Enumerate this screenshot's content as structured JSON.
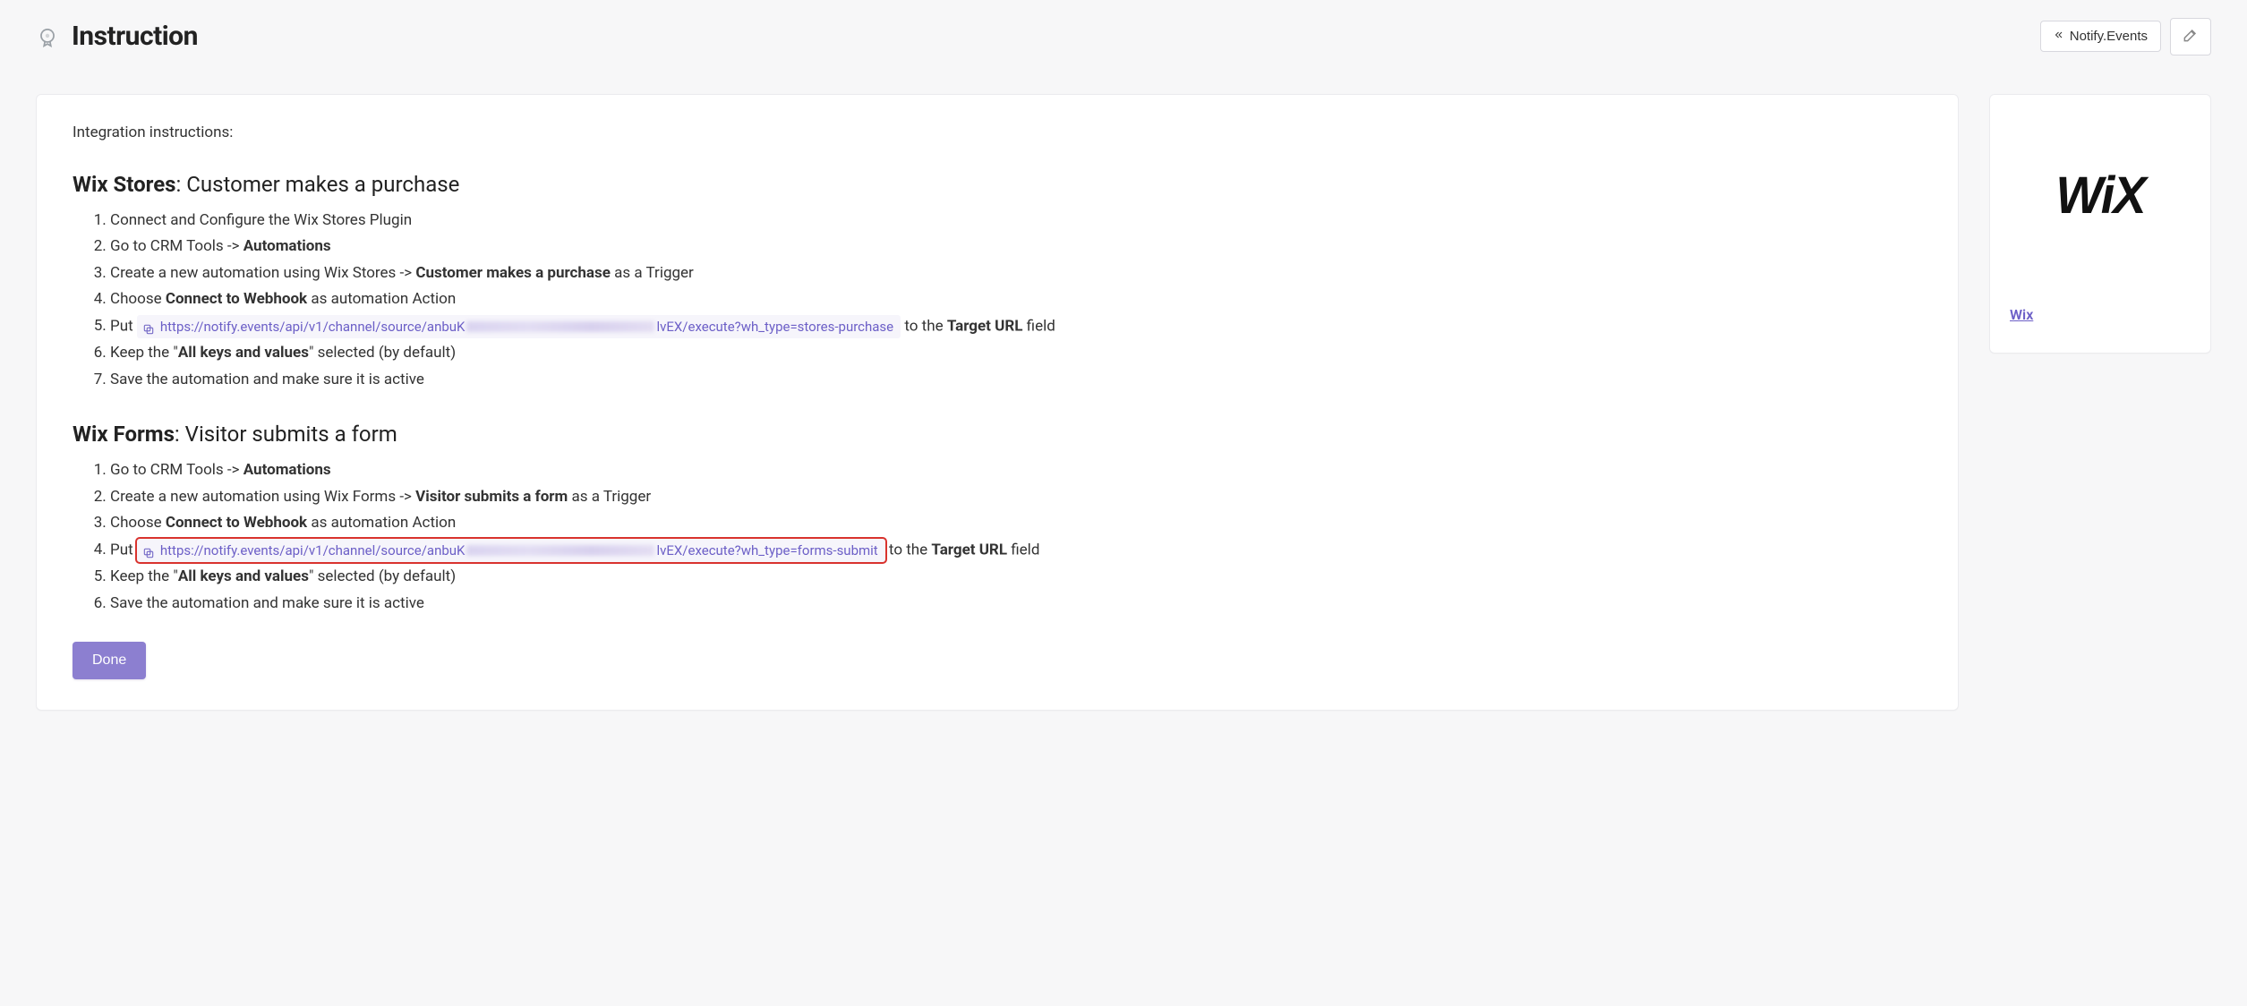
{
  "page": {
    "title": "Instruction",
    "back_button": "Notify.Events"
  },
  "intro": "Integration instructions:",
  "sections": [
    {
      "title_bold": "Wix Stores",
      "title_rest": ": Customer makes a purchase",
      "steps": [
        {
          "type": "text",
          "content": "Connect and Configure the Wix Stores Plugin"
        },
        {
          "type": "rich",
          "parts": [
            {
              "t": "Go to CRM Tools -> "
            },
            {
              "t": "Automations",
              "b": true
            }
          ]
        },
        {
          "type": "rich",
          "parts": [
            {
              "t": "Create a new automation using Wix Stores -> "
            },
            {
              "t": "Customer makes a purchase",
              "b": true
            },
            {
              "t": " as a Trigger"
            }
          ]
        },
        {
          "type": "rich",
          "parts": [
            {
              "t": "Choose "
            },
            {
              "t": "Connect to Webhook",
              "b": true
            },
            {
              "t": " as automation Action"
            }
          ]
        },
        {
          "type": "url",
          "prefix": "Put ",
          "url_a": "https://notify.events/api/v1/channel/source/anbuK",
          "url_b": "lvEX/execute?wh_type=stores-purchase",
          "mid": " to the ",
          "field": "Target URL",
          "suffix": " field",
          "highlighted": false
        },
        {
          "type": "rich",
          "parts": [
            {
              "t": "Keep the \""
            },
            {
              "t": "All keys and values",
              "b": true
            },
            {
              "t": "\" selected (by default)"
            }
          ]
        },
        {
          "type": "text",
          "content": "Save the automation and make sure it is active"
        }
      ]
    },
    {
      "title_bold": "Wix Forms",
      "title_rest": ": Visitor submits a form",
      "steps": [
        {
          "type": "rich",
          "parts": [
            {
              "t": "Go to CRM Tools -> "
            },
            {
              "t": "Automations",
              "b": true
            }
          ]
        },
        {
          "type": "rich",
          "parts": [
            {
              "t": "Create a new automation using Wix Forms -> "
            },
            {
              "t": "Visitor submits a form",
              "b": true
            },
            {
              "t": " as a Trigger"
            }
          ]
        },
        {
          "type": "rich",
          "parts": [
            {
              "t": "Choose "
            },
            {
              "t": "Connect to Webhook",
              "b": true
            },
            {
              "t": " as automation Action"
            }
          ]
        },
        {
          "type": "url",
          "prefix": "Put ",
          "url_a": "https://notify.events/api/v1/channel/source/anbuK",
          "url_b": "lvEX/execute?wh_type=forms-submit",
          "mid": " to the ",
          "field": "Target URL",
          "suffix": " field",
          "highlighted": true
        },
        {
          "type": "rich",
          "parts": [
            {
              "t": "Keep the \""
            },
            {
              "t": "All keys and values",
              "b": true
            },
            {
              "t": "\" selected (by default)"
            }
          ]
        },
        {
          "type": "text",
          "content": "Save the automation and make sure it is active"
        }
      ]
    }
  ],
  "done_label": "Done",
  "sidebar": {
    "logo_text": "WiX",
    "link": "Wix"
  }
}
